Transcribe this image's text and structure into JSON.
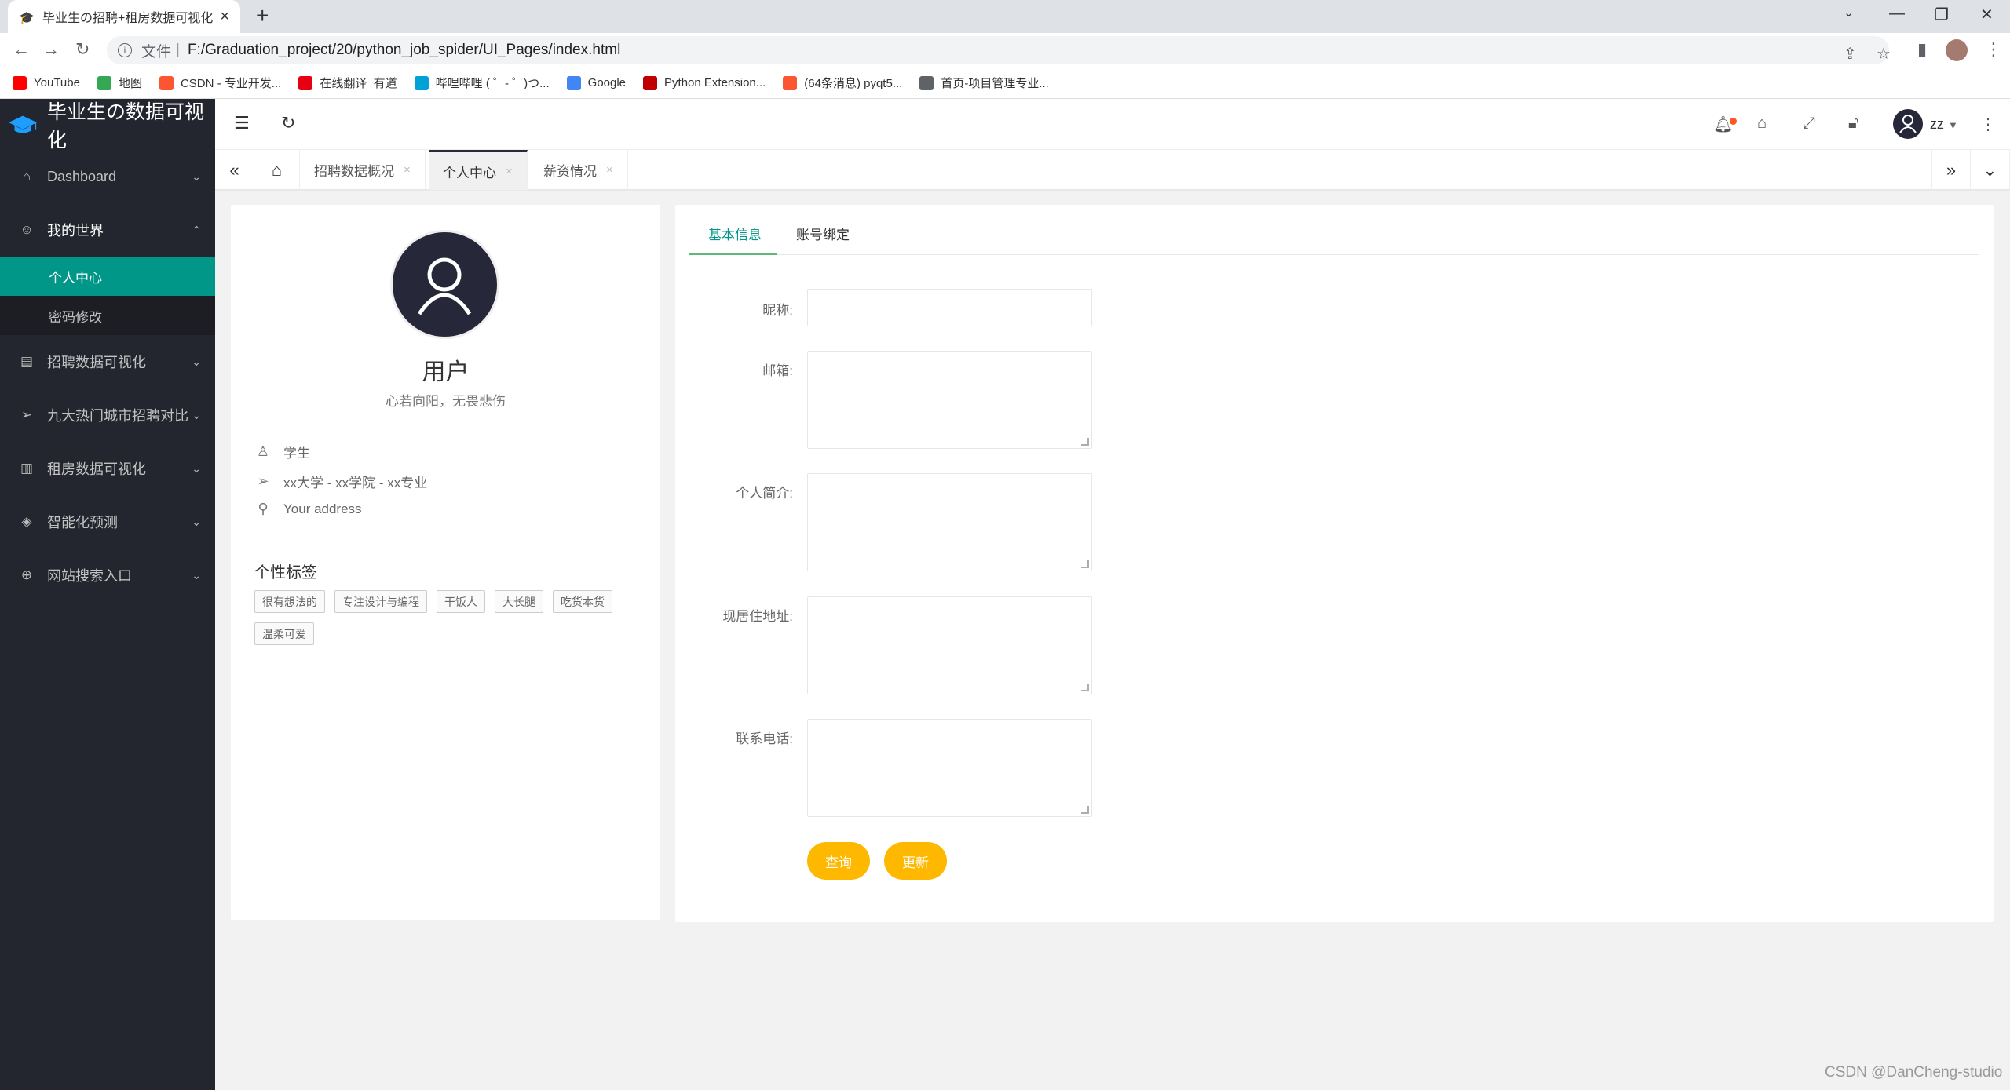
{
  "browser": {
    "tab_title": "毕业生の招聘+租房数据可视化系",
    "address_protocol": "文件",
    "address_url": "F:/Graduation_project/20/python_job_spider/UI_Pages/index.html",
    "bookmarks": [
      {
        "label": "YouTube",
        "icon": "youtube-icon",
        "color": "#ff0000"
      },
      {
        "label": "地图",
        "icon": "maps-icon",
        "color": "#34a853"
      },
      {
        "label": "CSDN - 专业开发...",
        "icon": "csdn-icon",
        "color": "#fc5531"
      },
      {
        "label": "在线翻译_有道",
        "icon": "youdao-icon",
        "color": "#e60012"
      },
      {
        "label": "哔哩哔哩 ( ゜- ゜)つ...",
        "icon": "bilibili-icon",
        "color": "#00a1d6"
      },
      {
        "label": "Google",
        "icon": "google-icon",
        "color": "#4285f4"
      },
      {
        "label": "Python Extension...",
        "icon": "python-ext-icon",
        "color": "#c00000"
      },
      {
        "label": "(64条消息) pyqt5...",
        "icon": "csdn-icon",
        "color": "#fc5531"
      },
      {
        "label": "首页-项目管理专业...",
        "icon": "globe-icon",
        "color": "#5f6368"
      }
    ]
  },
  "app": {
    "logo_text": "毕业生の数据可视化",
    "user_name": "zz",
    "accent": "#009688",
    "button_color": "#ffb800"
  },
  "sidebar": {
    "items": [
      {
        "label": "Dashboard",
        "icon": "home-icon",
        "expanded": false
      },
      {
        "label": "我的世界",
        "icon": "smile-icon",
        "expanded": true,
        "children": [
          {
            "label": "个人中心",
            "active": true
          },
          {
            "label": "密码修改",
            "active": false
          }
        ]
      },
      {
        "label": "招聘数据可视化",
        "icon": "form-icon",
        "expanded": false
      },
      {
        "label": "九大热门城市招聘对比",
        "icon": "send-icon",
        "expanded": false
      },
      {
        "label": "租房数据可视化",
        "icon": "read-icon",
        "expanded": false
      },
      {
        "label": "智能化预测",
        "icon": "diamond-icon",
        "expanded": false
      },
      {
        "label": "网站搜索入口",
        "icon": "globe-icon",
        "expanded": false
      }
    ]
  },
  "page_tabs": [
    {
      "label": "招聘数据概况",
      "active": false
    },
    {
      "label": "个人中心",
      "active": true
    },
    {
      "label": "薪资情况",
      "active": false
    }
  ],
  "profile": {
    "name": "用户",
    "motto": "心若向阳，无畏悲伤",
    "role": "学生",
    "school": "xx大学 - xx学院 - xx专业",
    "address": "Your address",
    "tags_title": "个性标签",
    "tags": [
      "很有想法的",
      "专注设计与编程",
      "干饭人",
      "大长腿",
      "吃货本货",
      "温柔可爱"
    ]
  },
  "form": {
    "tabs": [
      {
        "label": "基本信息",
        "active": true
      },
      {
        "label": "账号绑定",
        "active": false
      }
    ],
    "fields": [
      {
        "label": "昵称:",
        "value": ""
      },
      {
        "label": "邮箱:",
        "value": ""
      },
      {
        "label": "个人简介:",
        "value": ""
      },
      {
        "label": "现居住地址:",
        "value": ""
      },
      {
        "label": "联系电话:",
        "value": ""
      }
    ],
    "query_button": "查询",
    "update_button": "更新"
  },
  "watermark": "CSDN @DanCheng-studio"
}
